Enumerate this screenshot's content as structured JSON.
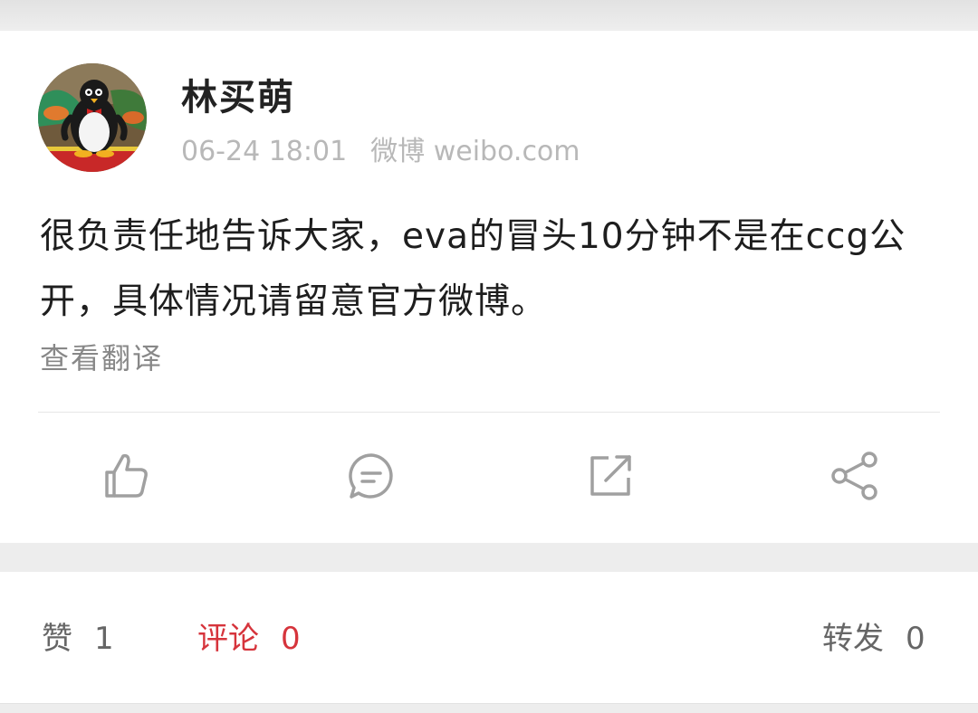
{
  "post": {
    "author": "林买萌",
    "timestamp": "06-24 18:01",
    "source": "微博 weibo.com",
    "content": "很负责任地告诉大家，eva的冒头10分钟不是在ccg公开，具体情况请留意官方微博。",
    "translate_link": "查看翻译",
    "avatar": "penguin-toy-avatar"
  },
  "actions": [
    {
      "name": "like",
      "icon": "thumbs-up-icon"
    },
    {
      "name": "comment",
      "icon": "comment-icon"
    },
    {
      "name": "repost",
      "icon": "repost-icon"
    },
    {
      "name": "share",
      "icon": "share-icon"
    }
  ],
  "stats": {
    "likes": {
      "label": "赞",
      "count": "1"
    },
    "comments": {
      "label": "评论",
      "count": "0"
    },
    "reposts": {
      "label": "转发",
      "count": "0"
    }
  },
  "colors": {
    "accent": "#d6343c",
    "icon_gray": "#a0a0a0",
    "background": "#ededed"
  }
}
